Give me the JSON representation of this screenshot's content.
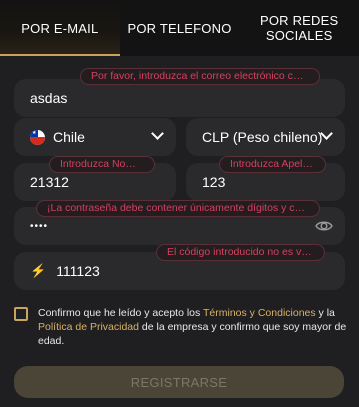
{
  "tabs": [
    {
      "label": "POR E-MAIL",
      "active": true
    },
    {
      "label": "POR TELEFONO",
      "active": false
    },
    {
      "label_line1": "POR REDES",
      "label_line2": "SOCIALES",
      "active": false
    }
  ],
  "email": {
    "value": "asdas",
    "error": "Por favor, introduzca el correo electrónico correcto"
  },
  "country": {
    "value": "Chile",
    "flag_icon": "chile-flag-icon"
  },
  "currency": {
    "value": "CLP (Peso chileno)"
  },
  "first_name": {
    "value": "21312",
    "error": "Introduzca Nombre"
  },
  "last_name": {
    "value": "123",
    "error": "Introduzca Apellido"
  },
  "password": {
    "value": "••••",
    "error": "¡La contraseña debe contener únicamente dígitos y caracter..."
  },
  "promo": {
    "value": "111123",
    "error": "El código introducido no es válido"
  },
  "terms": {
    "prefix": "Confirmo que he leído y acepto los ",
    "link1": "Términos y Condiciones",
    "middle": " y la ",
    "link2": "Política de Privacidad",
    "suffix": " de la empresa y confirmo que soy mayor de edad."
  },
  "submit": {
    "label": "REGISTRARSE"
  },
  "colors": {
    "accent": "#c9a45c",
    "error": "#d4405f",
    "field_bg": "#2a2a2c",
    "page_bg": "#1f1f21"
  }
}
